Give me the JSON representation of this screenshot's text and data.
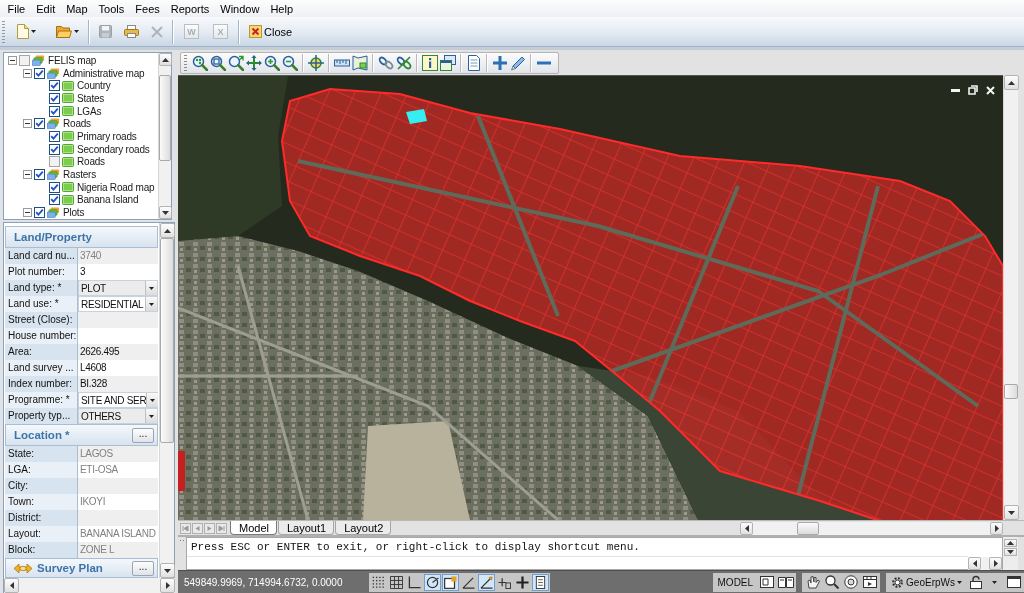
{
  "menu_bar": [
    "File",
    "Edit",
    "Map",
    "Tools",
    "Fees",
    "Reports",
    "Window",
    "Help"
  ],
  "toolbar": {
    "groups": [
      {
        "buttons": [
          {
            "kind": "new",
            "dropdown": true,
            "disabled": false
          },
          {
            "kind": "open",
            "dropdown": true,
            "disabled": false
          }
        ]
      },
      {
        "buttons": [
          {
            "kind": "save",
            "dropdown": false,
            "disabled": true
          },
          {
            "kind": "print",
            "dropdown": false,
            "disabled": false
          },
          {
            "kind": "delete",
            "dropdown": false,
            "disabled": true
          }
        ]
      },
      {
        "buttons": [
          {
            "kind": "letter",
            "text": "W",
            "dropdown": false,
            "disabled": true
          },
          {
            "kind": "letter",
            "text": "X",
            "dropdown": false,
            "disabled": true
          }
        ]
      },
      {
        "buttons": [
          {
            "kind": "close",
            "label": "Close",
            "dropdown": false,
            "disabled": false
          }
        ]
      }
    ]
  },
  "layer_tree": [
    {
      "label": "FELIS map",
      "checked": false,
      "expanded": true,
      "children": [
        {
          "label": "Administrative map",
          "checked": true,
          "expanded": true,
          "children": [
            {
              "label": "Country",
              "checked": true
            },
            {
              "label": "States",
              "checked": true
            },
            {
              "label": "LGAs",
              "checked": true
            }
          ]
        },
        {
          "label": "Roads",
          "checked": true,
          "expanded": true,
          "children": [
            {
              "label": "Primary roads",
              "checked": true
            },
            {
              "label": "Secondary roads",
              "checked": true
            },
            {
              "label": "Roads",
              "checked": false
            }
          ]
        },
        {
          "label": "Rasters",
          "checked": true,
          "expanded": true,
          "children": [
            {
              "label": "Nigeria Road map",
              "checked": true
            },
            {
              "label": "Banana Island",
              "checked": true
            }
          ]
        },
        {
          "label": "Plots",
          "checked": true,
          "expanded": true
        }
      ]
    }
  ],
  "properties": {
    "sections": [
      {
        "title": "Land/Property",
        "kind": "plain",
        "rows": [
          {
            "label": "Land card nu...",
            "kind": "text",
            "value": "3740",
            "disabled": true
          },
          {
            "label": "Plot number:",
            "kind": "text",
            "value": "3",
            "disabled": false
          },
          {
            "label": "Land type: *",
            "kind": "dropdown",
            "value": "PLOT",
            "disabled": false
          },
          {
            "label": "Land use: *",
            "kind": "dropdown",
            "value": "RESIDENTIAL",
            "disabled": false
          },
          {
            "label": "Street (Close):",
            "kind": "text"
          },
          {
            "label": "House number:",
            "kind": "text"
          },
          {
            "label": "Area:",
            "kind": "text",
            "value": "2626.495",
            "disabled": false
          },
          {
            "label": "Land survey ...",
            "kind": "text",
            "value": "L4608",
            "disabled": false
          },
          {
            "label": "Index number:",
            "kind": "text",
            "value": "BI.328",
            "disabled": false
          },
          {
            "label": "Programme: *",
            "kind": "dropdown",
            "value": "SITE AND SER",
            "disabled": false
          },
          {
            "label": "Property typ...",
            "kind": "dropdown",
            "value": "OTHERS",
            "disabled": false
          }
        ]
      },
      {
        "title": "Location *",
        "kind": "plain",
        "button": "...",
        "rows": [
          {
            "label": "State:",
            "kind": "text",
            "value": "LAGOS",
            "disabled": true
          },
          {
            "label": "LGA:",
            "kind": "text",
            "value": "ETI-OSA",
            "disabled": true
          },
          {
            "label": "City:",
            "kind": "text"
          },
          {
            "label": "Town:",
            "kind": "text",
            "value": "IKOYI",
            "disabled": true
          },
          {
            "label": "District:",
            "kind": "text"
          },
          {
            "label": "Layout:",
            "kind": "text",
            "value": "BANANA ISLAND",
            "disabled": true
          },
          {
            "label": "Block:",
            "kind": "text",
            "value": "ZONE L",
            "disabled": true
          }
        ]
      },
      {
        "title": "Survey Plan",
        "kind": "with-icon",
        "button": "..."
      }
    ]
  },
  "map_view": {
    "tabs": [
      {
        "label": "Model",
        "selected": true
      },
      {
        "label": "Layout1",
        "selected": false
      },
      {
        "label": "Layout2",
        "selected": false
      }
    ]
  },
  "command_line": {
    "history": "Press ESC or ENTER to exit, or right-click to display shortcut menu."
  },
  "status_bar": {
    "coordinates": "549849.9969, 714994.6732, 0.0000",
    "toggles": [
      {
        "kind": "snap",
        "on": false
      },
      {
        "kind": "grid",
        "on": false
      },
      {
        "kind": "ortho",
        "on": false
      },
      {
        "kind": "polar",
        "on": true
      },
      {
        "kind": "osnap",
        "on": true
      },
      {
        "kind": "otrack",
        "on": false
      },
      {
        "kind": "ducs",
        "on": true
      },
      {
        "kind": "dyn",
        "on": false
      },
      {
        "kind": "lineweight",
        "on": false
      },
      {
        "kind": "quick-properties",
        "on": true
      }
    ],
    "model_button": "MODEL",
    "workspace": "GeoErpWs"
  }
}
